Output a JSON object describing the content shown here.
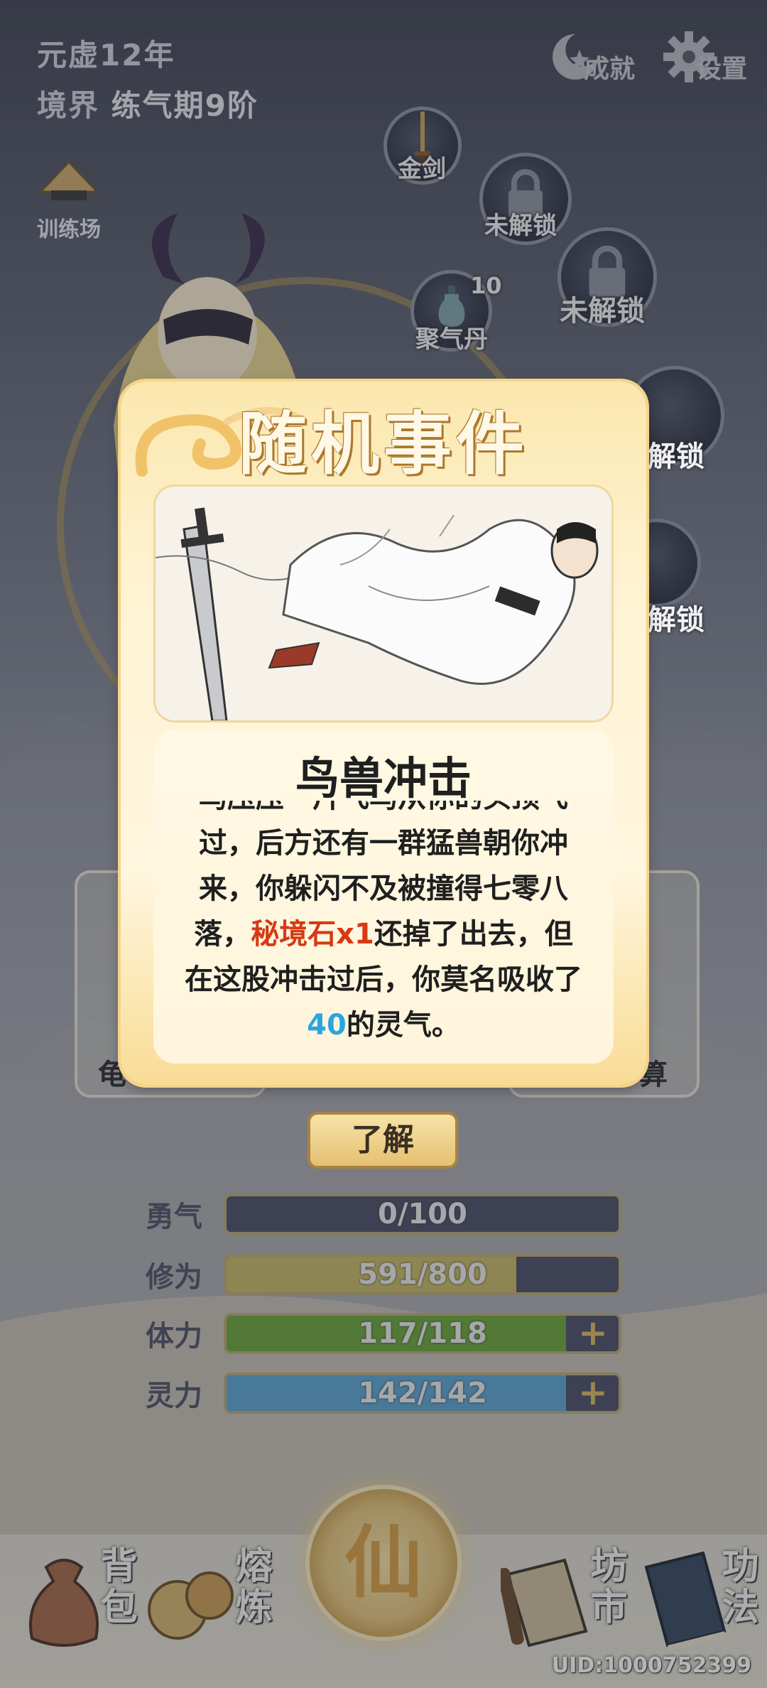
{
  "header": {
    "era": "元虚12年",
    "realm_prefix": "境界",
    "realm_value": "练气期9阶"
  },
  "top_buttons": {
    "achievements": "成就",
    "settings": "设置"
  },
  "training_ground": "训练场",
  "skill_nodes": {
    "gold_sword": "金剑",
    "locked": "未解锁",
    "qi_pill": "聚气丹",
    "qi_pill_count": "10",
    "locked_partial": "解锁"
  },
  "peek_labels": {
    "left": "龟",
    "right": "算"
  },
  "modal": {
    "title": "随机事件",
    "event_name": "鸟兽冲击",
    "body_hidden_line": "鸟压压一片飞鸟从你的头顶飞",
    "body_line1": "过，后方还有一群猛兽朝你冲",
    "body_line2": "来，你躲闪不及被撞得七零八",
    "body_line3_pre": "落，",
    "body_item": "秘境石x1",
    "body_line3_post": "还掉了出去，但",
    "body_line4": "在这股冲击过后，你莫名吸收了",
    "body_amount": "40",
    "body_line5_post": "的灵气。",
    "confirm": "了解"
  },
  "stats": [
    {
      "label": "勇气",
      "value": "0/100",
      "fraction": 0.0,
      "color": "#4a4e66"
    },
    {
      "label": "修为",
      "value": "591/800",
      "fraction": 0.74,
      "color": "#c3b765"
    },
    {
      "label": "体力",
      "value": "117/118",
      "fraction": 0.99,
      "color": "#69a33a"
    },
    {
      "label": "灵力",
      "value": "142/142",
      "fraction": 1.0,
      "color": "#5aa3cf"
    }
  ],
  "bottom_nav": {
    "bag": "背包",
    "smelt": "熔炼",
    "center": "仙",
    "market": "坊市",
    "skills": "功法"
  },
  "uid": "UID:1000752399",
  "icons": {
    "achievements": "medal-icon",
    "settings": "gear-icon",
    "training": "straw-hat-icon",
    "locked": "padlock-icon",
    "bag": "pouch-icon",
    "smelt": "ore-icon",
    "market": "scroll-icon",
    "skills": "book-icon"
  }
}
